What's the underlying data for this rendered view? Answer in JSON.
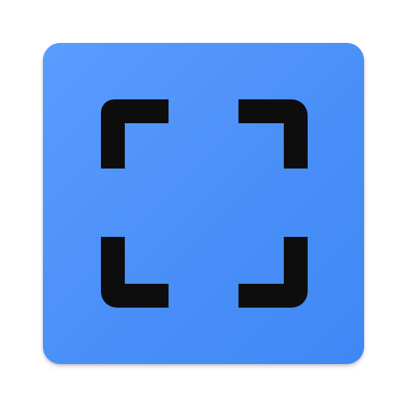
{
  "app_icon": {
    "icon_name": "fullscreen-frame-icon",
    "background_color": "#4a8ff8",
    "glyph_color": "#0d0d0d"
  }
}
